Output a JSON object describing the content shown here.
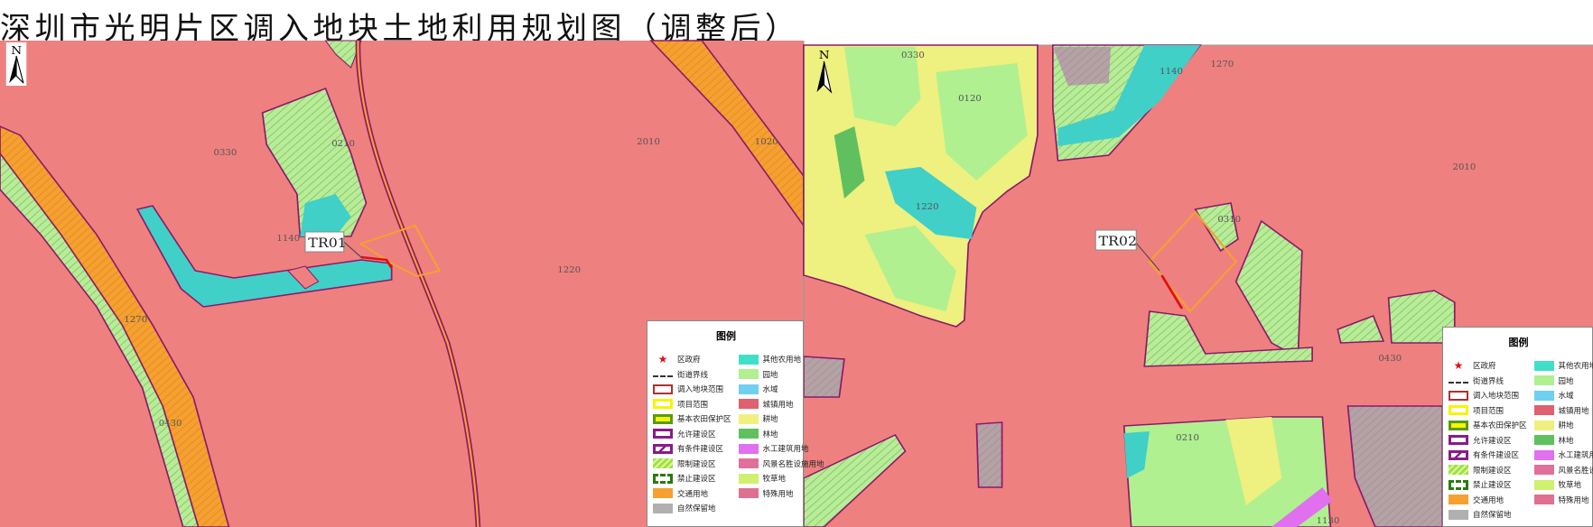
{
  "title": "深圳市光明片区调入地块土地利用规划图（调整后）",
  "north_label": "N",
  "left_map": {
    "callout": "TR01",
    "labels": [
      "0330",
      "0210",
      "2010",
      "1020",
      "1140",
      "1220",
      "1270",
      "0430"
    ]
  },
  "right_map": {
    "callout": "TR02",
    "labels": [
      "0330",
      "0120",
      "1140",
      "1270",
      "1220",
      "2010",
      "0310",
      "0430",
      "0210",
      "1130"
    ]
  },
  "legend": {
    "title": "图例",
    "left_items": [
      {
        "label": "区政府",
        "icon": "star-icon",
        "color": "#e01010"
      },
      {
        "label": "街道界线",
        "icon": "dash-line-icon",
        "color": "#333333"
      },
      {
        "label": "调入地块范围",
        "icon": "outline-box",
        "color": "#b03030"
      },
      {
        "label": "项目范围",
        "icon": "outline-box",
        "color": "#f5f500"
      },
      {
        "label": "基本农田保护区",
        "icon": "outline-box",
        "color": "#5a9a10"
      },
      {
        "label": "允许建设区",
        "icon": "outline-box",
        "color": "#8a1a8a"
      },
      {
        "label": "有条件建设区",
        "icon": "hatched-box",
        "color": "#8a1a8a"
      },
      {
        "label": "限制建设区",
        "icon": "hatched-box",
        "color": "#a0e040"
      },
      {
        "label": "禁止建设区",
        "icon": "dashed-box",
        "color": "#2a7a10"
      },
      {
        "label": "交通用地",
        "icon": "fill-box",
        "color": "#f5a030"
      },
      {
        "label": "自然保留地",
        "icon": "fill-box",
        "color": "#b0b0b0"
      }
    ],
    "right_items": [
      {
        "label": "其他农用地",
        "color": "#40e0c8"
      },
      {
        "label": "园地",
        "color": "#b0f090"
      },
      {
        "label": "水域",
        "color": "#70d0f0"
      },
      {
        "label": "城镇用地",
        "color": "#e06070"
      },
      {
        "label": "耕地",
        "color": "#f0f080"
      },
      {
        "label": "林地",
        "color": "#60c060"
      },
      {
        "label": "水工建筑用地",
        "color": "#e070f0"
      },
      {
        "label": "风景名胜设施用地",
        "color": "#e0709a"
      },
      {
        "label": "牧草地",
        "color": "#d0f070"
      },
      {
        "label": "特殊用地",
        "color": "#e07090"
      }
    ]
  },
  "colors": {
    "urban": "#ef8080",
    "road": "#f5a030",
    "water": "#40d0c8",
    "green": "#b0f090",
    "yellow": "#eef080",
    "grey": "#b0a0a0",
    "boundary": "#8a1a6a"
  }
}
